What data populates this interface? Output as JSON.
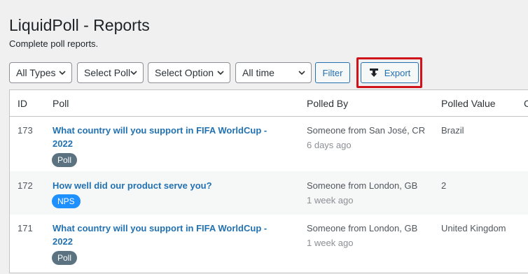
{
  "page": {
    "title": "LiquidPoll - Reports",
    "subtitle": "Complete poll reports."
  },
  "filters": {
    "type": "All Types",
    "poll": "Select Poll",
    "option": "Select Option",
    "time": "All time",
    "filter_label": "Filter",
    "export_label": "Export"
  },
  "table": {
    "columns": [
      "ID",
      "Poll",
      "Polled By",
      "Polled Value",
      "C"
    ],
    "rows": [
      {
        "id": "173",
        "poll_line1": "What country will you support in FIFA WorldCup -",
        "poll_line2": "2022",
        "badge": "Poll",
        "polled_by": "Someone from San José, CR",
        "ago": "6 days ago",
        "value": "Brazil"
      },
      {
        "id": "172",
        "poll_line1": "How well did our product serve you?",
        "poll_line2": "",
        "badge": "NPS",
        "polled_by": "Someone from London, GB",
        "ago": "1 week ago",
        "value": "2"
      },
      {
        "id": "171",
        "poll_line1": "What country will you support in FIFA WorldCup -",
        "poll_line2": "2022",
        "badge": "Poll",
        "polled_by": "Someone from London, GB",
        "ago": "1 week ago",
        "value": "United Kingdom"
      }
    ]
  },
  "colors": {
    "accent": "#2271b1",
    "highlight": "#d0121b",
    "badge_poll": "#5b7381",
    "badge_nps": "#1e90ff"
  }
}
